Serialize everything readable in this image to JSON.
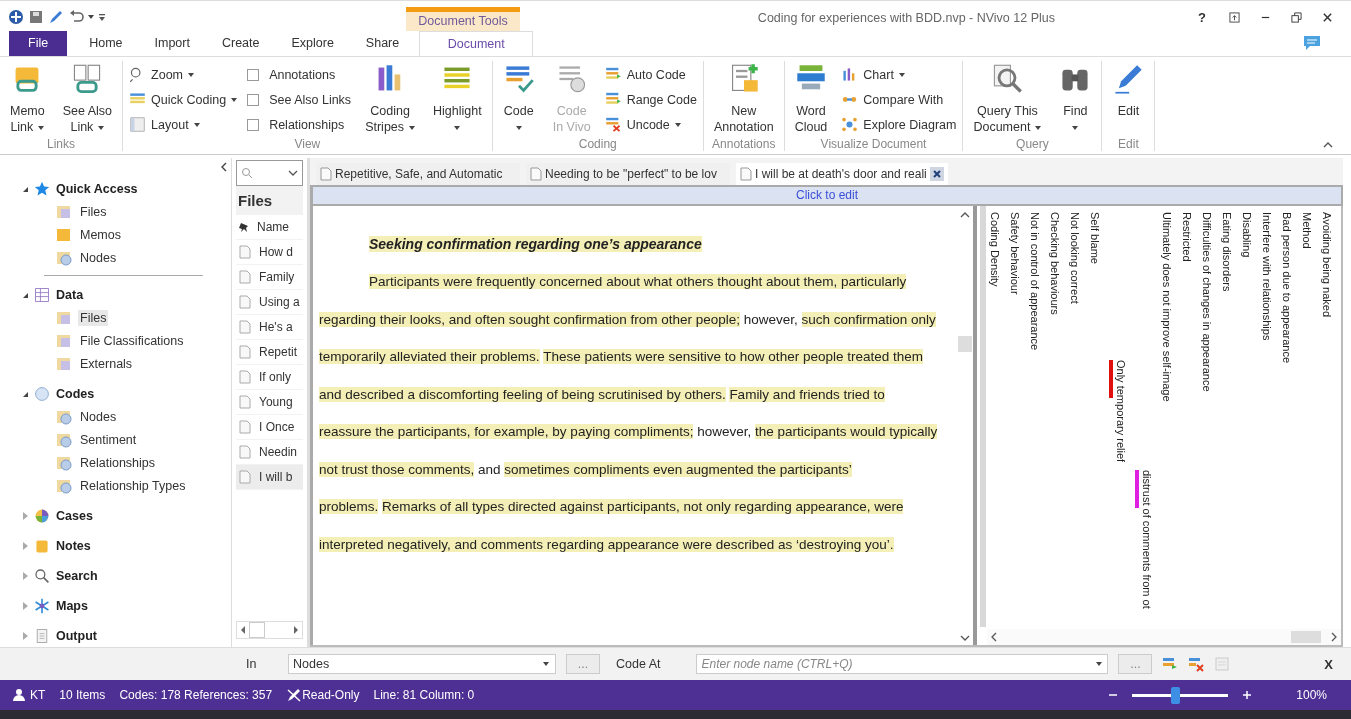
{
  "title_bar": {
    "context_header": "Document Tools",
    "title": "Coding for experiences with BDD.nvp - NVivo 12 Plus",
    "help": "?"
  },
  "ribbon_tabs": [
    {
      "label": "File",
      "kind": "file",
      "selected": false
    },
    {
      "label": "Home",
      "kind": "tab",
      "selected": false
    },
    {
      "label": "Import",
      "kind": "tab",
      "selected": false
    },
    {
      "label": "Create",
      "kind": "tab",
      "selected": false
    },
    {
      "label": "Explore",
      "kind": "tab",
      "selected": false
    },
    {
      "label": "Share",
      "kind": "tab",
      "selected": false
    },
    {
      "label": "Document",
      "kind": "tab",
      "selected": true
    }
  ],
  "ribbon_groups": [
    {
      "label": "Links",
      "items": [
        {
          "kind": "large",
          "lines": [
            "Memo",
            "Link"
          ],
          "dropdown": true,
          "disabled": false
        },
        {
          "kind": "large",
          "lines": [
            "See Also",
            "Link"
          ],
          "dropdown": true,
          "disabled": false
        }
      ]
    },
    {
      "label": "View",
      "items": [
        {
          "kind": "stack",
          "items": [
            {
              "kind": "small",
              "label": "Zoom",
              "dropdown": true
            },
            {
              "kind": "small",
              "label": "Quick Coding",
              "dropdown": true
            },
            {
              "kind": "small",
              "label": "Layout",
              "dropdown": true
            }
          ]
        },
        {
          "kind": "stack",
          "items": [
            {
              "kind": "check",
              "label": "Annotations",
              "checked": false
            },
            {
              "kind": "check",
              "label": "See Also Links",
              "checked": false
            },
            {
              "kind": "check",
              "label": "Relationships",
              "checked": false
            }
          ]
        },
        {
          "kind": "large",
          "lines": [
            "Coding",
            "Stripes"
          ],
          "dropdown": true,
          "disabled": false
        },
        {
          "kind": "large",
          "lines": [
            "Highlight"
          ],
          "dropdown": true,
          "disabled": false
        }
      ]
    },
    {
      "label": "Coding",
      "items": [
        {
          "kind": "large",
          "lines": [
            "Code"
          ],
          "dropdown": true,
          "disabled": false
        },
        {
          "kind": "large",
          "lines": [
            "Code",
            "In Vivo"
          ],
          "dropdown": false,
          "disabled": true
        },
        {
          "kind": "stack",
          "items": [
            {
              "kind": "small",
              "label": "Auto Code",
              "dropdown": false
            },
            {
              "kind": "small",
              "label": "Range Code",
              "dropdown": false
            },
            {
              "kind": "small",
              "label": "Uncode",
              "dropdown": true
            }
          ]
        }
      ]
    },
    {
      "label": "Annotations",
      "items": [
        {
          "kind": "large",
          "lines": [
            "New",
            "Annotation"
          ],
          "dropdown": false,
          "disabled": false
        }
      ]
    },
    {
      "label": "Visualize Document",
      "items": [
        {
          "kind": "large",
          "lines": [
            "Word",
            "Cloud"
          ],
          "dropdown": false,
          "disabled": false
        },
        {
          "kind": "stack",
          "items": [
            {
              "kind": "small",
              "label": "Chart",
              "dropdown": true
            },
            {
              "kind": "small",
              "label": "Compare With",
              "dropdown": false
            },
            {
              "kind": "small",
              "label": "Explore Diagram",
              "dropdown": false
            }
          ]
        }
      ]
    },
    {
      "label": "Query",
      "items": [
        {
          "kind": "large",
          "lines": [
            "Query This",
            "Document"
          ],
          "dropdown": true,
          "disabled": false
        },
        {
          "kind": "large",
          "lines": [
            "Find"
          ],
          "dropdown": true,
          "disabled": false
        }
      ]
    },
    {
      "label": "Edit",
      "items": [
        {
          "kind": "large",
          "lines": [
            "Edit"
          ],
          "dropdown": false,
          "disabled": false
        }
      ]
    }
  ],
  "navigation": [
    {
      "label": "Quick Access",
      "expanded": true,
      "children": [
        {
          "label": "Files",
          "selected": false
        },
        {
          "label": "Memos",
          "selected": false
        },
        {
          "label": "Nodes",
          "selected": false
        }
      ]
    },
    {
      "label": "Data",
      "expanded": true,
      "children": [
        {
          "label": "Files",
          "selected": true
        },
        {
          "label": "File Classifications",
          "selected": false
        },
        {
          "label": "Externals",
          "selected": false
        }
      ]
    },
    {
      "label": "Codes",
      "expanded": true,
      "children": [
        {
          "label": "Nodes",
          "selected": false
        },
        {
          "label": "Sentiment",
          "selected": false
        },
        {
          "label": "Relationships",
          "selected": false
        },
        {
          "label": "Relationship Types",
          "selected": false
        }
      ]
    },
    {
      "label": "Cases",
      "expanded": false
    },
    {
      "label": "Notes",
      "expanded": false
    },
    {
      "label": "Search",
      "expanded": false
    },
    {
      "label": "Maps",
      "expanded": false
    },
    {
      "label": "Output",
      "expanded": false
    }
  ],
  "files_pane": {
    "title": "Files",
    "column": "Name",
    "rows": [
      {
        "name": "How d",
        "selected": false
      },
      {
        "name": "Family",
        "selected": false
      },
      {
        "name": "Using a",
        "selected": false
      },
      {
        "name": "He's a",
        "selected": false
      },
      {
        "name": "Repetit",
        "selected": false
      },
      {
        "name": "If only",
        "selected": false
      },
      {
        "name": "Young",
        "selected": false
      },
      {
        "name": "I Once",
        "selected": false
      },
      {
        "name": "Needin",
        "selected": false
      },
      {
        "name": "I will b",
        "selected": true
      }
    ]
  },
  "document_tabs": [
    {
      "label": "Repetitive, Safe, and Automatic",
      "selected": false
    },
    {
      "label": "Needing to be \"perfect\" to be lov",
      "selected": false
    },
    {
      "label": "I will be at death's door and reali",
      "selected": true
    }
  ],
  "edit_bar": "Click to edit",
  "document": {
    "heading": "Seeking confirmation regarding one’s appearance",
    "paragraph": [
      {
        "text": "Participants were frequently concerned about what others thought about them, particularly regarding their looks, and often sought confirmation from other people;",
        "coded": true
      },
      {
        "text": " however, ",
        "coded": false
      },
      {
        "text": "such confirmation only temporarily alleviated their problems.",
        "coded": true
      },
      {
        "text": "These patients were sensitive to how other people treated them and described a discomforting feeling of being scrutinised by others.",
        "coded": true
      },
      {
        "text": "Family and friends tried to reassure the participants, for example, by paying compliments;",
        "coded": true
      },
      {
        "text": " however, ",
        "coded": false
      },
      {
        "text": "the participants would typically not trust those comments,",
        "coded": true
      },
      {
        "text": " and ",
        "coded": false
      },
      {
        "text": "sometimes compliments even augmented the participants’ problems.",
        "coded": true
      },
      {
        "text": "Remarks of all types directed against participants, not only regarding appearance, were interpreted negatively, and comments regarding appearance were described as ‘destroying you’.",
        "coded": true
      }
    ]
  },
  "coding_stripes": [
    {
      "label": "Avoiding being naked",
      "kind": "header"
    },
    {
      "label": "Method",
      "kind": "header"
    },
    {
      "label": "Bad person due to appearance",
      "kind": "header"
    },
    {
      "label": "Interfere with relationships",
      "kind": "header"
    },
    {
      "label": "Disabling",
      "kind": "header"
    },
    {
      "label": "Eating disorders",
      "kind": "header"
    },
    {
      "label": "Difficulties of changes in appearance",
      "kind": "header"
    },
    {
      "label": "Restricted",
      "kind": "header"
    },
    {
      "label": "Ultimately does not improve self-image",
      "kind": "header"
    },
    {
      "label": "distrust of comments from ot",
      "kind": "stripe",
      "color": "#e020e0"
    },
    {
      "label": "Only temporary relief",
      "kind": "stripe",
      "color": "#e01010"
    },
    {
      "label": "Self blame",
      "kind": "header"
    },
    {
      "label": "Not looking correct",
      "kind": "header"
    },
    {
      "label": "Checking behaviours",
      "kind": "header"
    },
    {
      "label": "Not in control of appearance",
      "kind": "header"
    },
    {
      "label": "Safety behaviour",
      "kind": "header"
    },
    {
      "label": "Coding Density",
      "kind": "header"
    }
  ],
  "coding_bar": {
    "in_label": "In",
    "in_value": "Nodes",
    "browse": "...",
    "code_at_label": "Code At",
    "node_placeholder": "Enter node name (CTRL+Q)",
    "browse_2": "...",
    "close": "X"
  },
  "status_bar": {
    "user": "KT",
    "items": "10 Items",
    "codes": "Codes: 178 References: 357",
    "mode": "Read-Only",
    "position": "Line: 81 Column: 0",
    "zoom_level": {
      "level": 0.45
    },
    "zoom": "100%"
  }
}
